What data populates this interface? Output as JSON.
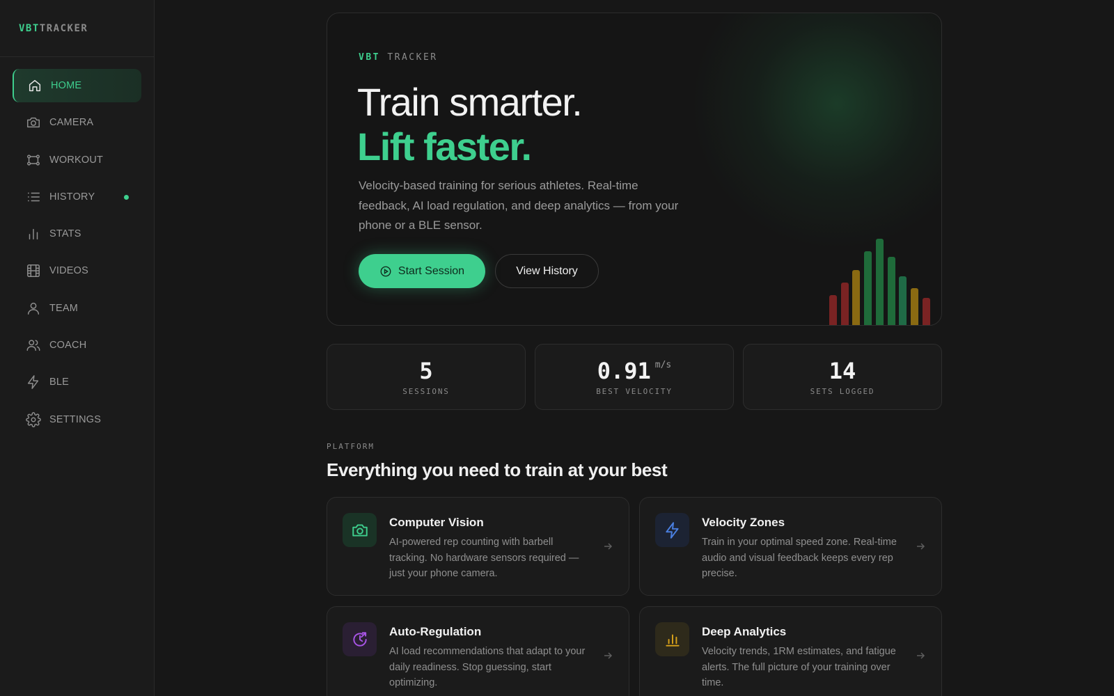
{
  "brand": {
    "part1": "VBT",
    "part2": "TRACKER"
  },
  "nav": {
    "items": [
      {
        "label": "HOME",
        "icon": "home-icon",
        "active": true
      },
      {
        "label": "CAMERA",
        "icon": "camera-icon"
      },
      {
        "label": "WORKOUT",
        "icon": "workout-icon"
      },
      {
        "label": "HISTORY",
        "icon": "list-icon",
        "indicator": true
      },
      {
        "label": "STATS",
        "icon": "bar-chart-icon"
      },
      {
        "label": "VIDEOS",
        "icon": "film-icon"
      },
      {
        "label": "TEAM",
        "icon": "user-icon"
      },
      {
        "label": "COACH",
        "icon": "users-icon"
      },
      {
        "label": "BLE",
        "icon": "bolt-icon"
      },
      {
        "label": "SETTINGS",
        "icon": "gear-icon"
      }
    ]
  },
  "hero": {
    "tag1": "VBT",
    "tag2": "TRACKER",
    "headline1": "Train smarter.",
    "headline2": "Lift faster.",
    "description": "Velocity-based training for serious athletes. Real-time feedback, AI load regulation, and deep analytics — from your phone or a BLE sensor.",
    "primary_button": "Start Session",
    "secondary_button": "View History",
    "decor_bars": {
      "levels": [
        0.34,
        0.49,
        0.63,
        0.85,
        0.99,
        0.78,
        0.56,
        0.42,
        0.31
      ],
      "colors": [
        "#7a2323",
        "#7a2323",
        "#8a6a12",
        "#1f6b3a",
        "#1f6b3a",
        "#1f6b3a",
        "#1f6b46",
        "#8a6a12",
        "#7a2323"
      ]
    }
  },
  "stats": [
    {
      "value": "5",
      "unit": "",
      "label": "SESSIONS"
    },
    {
      "value": "0.91",
      "unit": "m/s",
      "label": "BEST VELOCITY"
    },
    {
      "value": "14",
      "unit": "",
      "label": "SETS LOGGED"
    }
  ],
  "platform": {
    "tag": "PLATFORM",
    "title": "Everything you need to train at your best",
    "cards": [
      {
        "title": "Computer Vision",
        "description": "AI-powered rep counting with barbell tracking. No hardware sensors required — just your phone camera.",
        "icon": "camera-icon",
        "accent": "#3ecf8e",
        "icon_bg": "#1a3326"
      },
      {
        "title": "Velocity Zones",
        "description": "Train in your optimal speed zone. Real-time audio and visual feedback keeps every rep precise.",
        "icon": "bolt-icon",
        "accent": "#4a7fe0",
        "icon_bg": "#1c2333"
      },
      {
        "title": "Auto-Regulation",
        "description": "AI load recommendations that adapt to your daily readiness. Stop guessing, start optimizing.",
        "icon": "auto-regulation-icon",
        "accent": "#a855e6",
        "icon_bg": "#2a1f33"
      },
      {
        "title": "Deep Analytics",
        "description": "Velocity trends, 1RM estimates, and fatigue alerts. The full picture of your training over time.",
        "icon": "bar-chart-icon",
        "accent": "#d9a21a",
        "icon_bg": "#2e2a1b"
      }
    ]
  }
}
